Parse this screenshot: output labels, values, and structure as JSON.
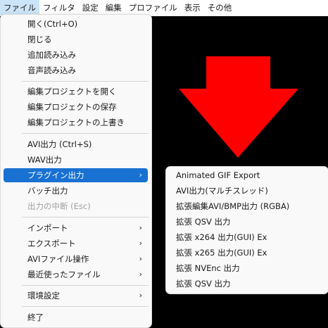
{
  "menubar": [
    "ファイル",
    "フィルタ",
    "設定",
    "編集",
    "プロファイル",
    "表示",
    "その他"
  ],
  "file_menu": [
    {
      "label": "開く(Ctrl+O)"
    },
    {
      "label": "閉じる"
    },
    {
      "label": "追加読み込み"
    },
    {
      "label": "音声読み込み"
    },
    {
      "label": "編集プロジェクトを開く"
    },
    {
      "label": "編集プロジェクトの保存"
    },
    {
      "label": "編集プロジェクトの上書き"
    },
    {
      "label": "AVI出力 (Ctrl+S)"
    },
    {
      "label": "WAV出力"
    },
    {
      "label": "プラグイン出力",
      "arrow": "›"
    },
    {
      "label": "バッチ出力"
    },
    {
      "label": "出力の中断 (Esc)"
    },
    {
      "label": "インポート",
      "arrow": "›"
    },
    {
      "label": "エクスポート",
      "arrow": "›"
    },
    {
      "label": "AVIファイル操作",
      "arrow": "›"
    },
    {
      "label": "最近使ったファイル",
      "arrow": "›"
    },
    {
      "label": "環境設定",
      "arrow": "›"
    },
    {
      "label": "終了"
    }
  ],
  "plugin_output_submenu": [
    "Animated GIF Export",
    "AVI出力(マルチスレッド)",
    "拡張編集AVI/BMP出力 (RGBA)",
    "拡張 QSV 出力",
    "拡張 x264 出力(GUI) Ex",
    "拡張 x265 出力(GUI) Ex",
    "拡張 NVEnc 出力",
    "拡張 QSV 出力"
  ],
  "colors": {
    "highlight": "#1971d2",
    "preview_background": "#000000",
    "arrow_shape": "#ff0000"
  }
}
